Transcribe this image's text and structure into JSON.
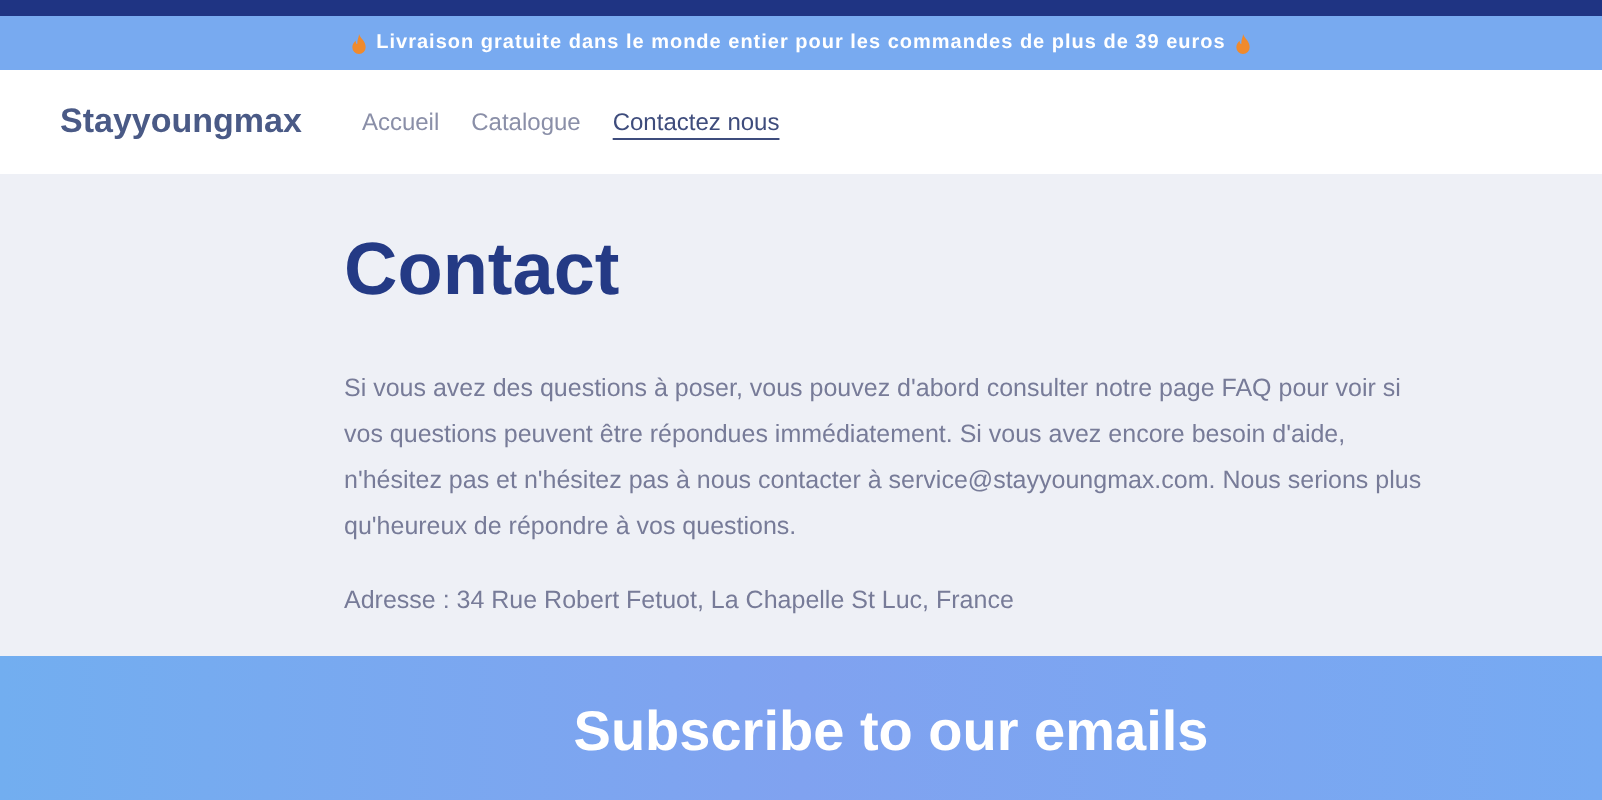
{
  "announcement": {
    "text": "Livraison gratuite dans le monde entier pour les commandes de plus de 39 euros"
  },
  "header": {
    "brand": "Stayyoungmax",
    "nav": [
      {
        "label": "Accueil",
        "selected": false
      },
      {
        "label": "Catalogue",
        "selected": false
      },
      {
        "label": "Contactez nous",
        "selected": true
      }
    ]
  },
  "main": {
    "title": "Contact",
    "paragraph": "Si vous avez des questions à poser, vous pouvez d'abord consulter notre page FAQ pour voir si vos questions peuvent être répondues immédiatement. Si vous avez encore besoin d'aide, n'hésitez pas et n'hésitez pas à nous contacter à service@stayyoungmax.com. Nous serions plus qu'heureux de répondre à vos questions.",
    "address": "Adresse : 34 Rue Robert Fetuot, La Chapelle St Luc, France"
  },
  "newsletter": {
    "title": "Subscribe to our emails"
  }
}
